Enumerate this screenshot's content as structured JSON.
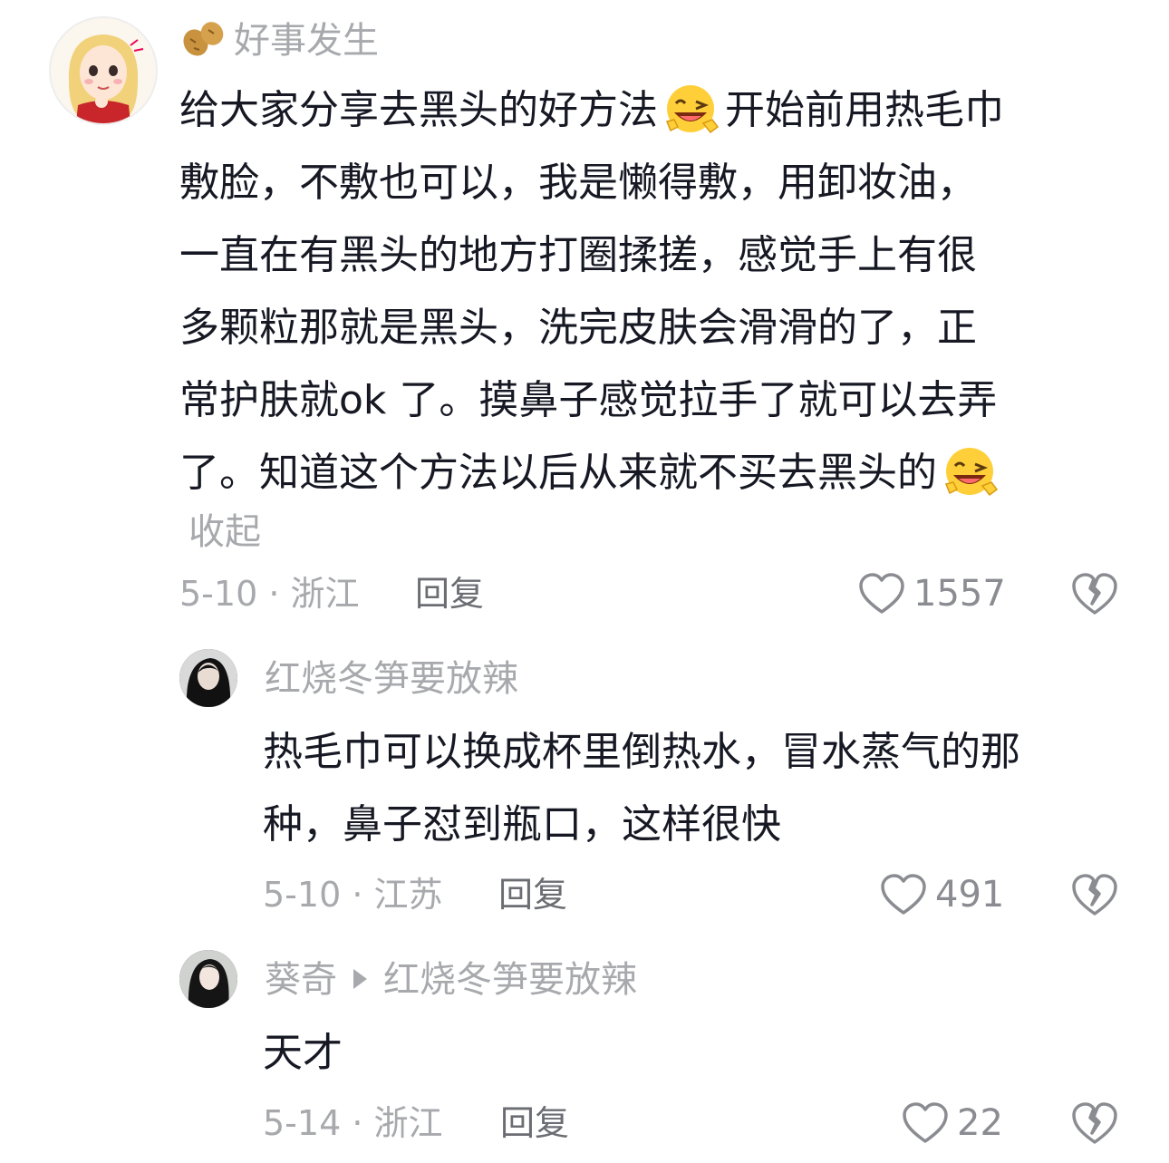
{
  "comments": [
    {
      "username": "好事发生",
      "text_lines": [
        "给大家分享去黑头的好方法",
        "开始前用热毛巾",
        "敷脸，不敷也可以，我是懒得敷，用卸妆油，",
        "一直在有黑头的地方打圈揉搓，感觉手上有很",
        "多颗粒那就是黑头，洗完皮肤会滑滑的了，正",
        "常护肤就ok 了。摸鼻子感觉拉手了就可以去弄",
        "了。知道这个方法以后从来就不买去黑头的"
      ],
      "collapse_label": "收起",
      "date_location": "5-10 · 浙江",
      "reply_label": "回复",
      "likes": "1557",
      "emoji_name": "grinning-wink-emoji",
      "badge_icon": "peanut-icon"
    },
    {
      "username": "红烧冬笋要放辣",
      "text_lines": [
        "热毛巾可以换成杯里倒热水，冒水蒸气的那",
        "种，鼻子怼到瓶口，这样很快"
      ],
      "date_location": "5-10 · 江苏",
      "reply_label": "回复",
      "likes": "491"
    },
    {
      "username": "葵奇",
      "reply_to": "红烧冬笋要放辣",
      "text_lines": [
        "天才"
      ],
      "date_location": "5-14 · 浙江",
      "reply_label": "回复",
      "likes": "22"
    }
  ],
  "colors": {
    "text": "#161823",
    "secondary": "#a7a9ad",
    "reply": "#6b6d73"
  }
}
